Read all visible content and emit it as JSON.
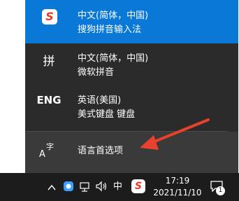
{
  "language_list": [
    {
      "icon": "sogou-icon",
      "name": "中文(简体，中国)",
      "sub": "搜狗拼音输入法",
      "selected": true
    },
    {
      "icon": "拼",
      "name": "中文(简体，中国)",
      "sub": "微软拼音",
      "selected": false
    },
    {
      "icon": "ENG",
      "name": "英语(美国)",
      "sub": "美式键盘 键盘",
      "selected": false
    }
  ],
  "preferences": {
    "label": "语言首选项",
    "icon_text": "A字"
  },
  "taskbar": {
    "ime_indicator": "中",
    "time": "17:19",
    "date": "2021/11/10",
    "notification_count": "1"
  },
  "colors": {
    "accent": "#0a78d7",
    "flyout_bg": "#2b2b2b",
    "taskbar_bg": "#1c1c1c",
    "arrow": "#e8412c"
  }
}
